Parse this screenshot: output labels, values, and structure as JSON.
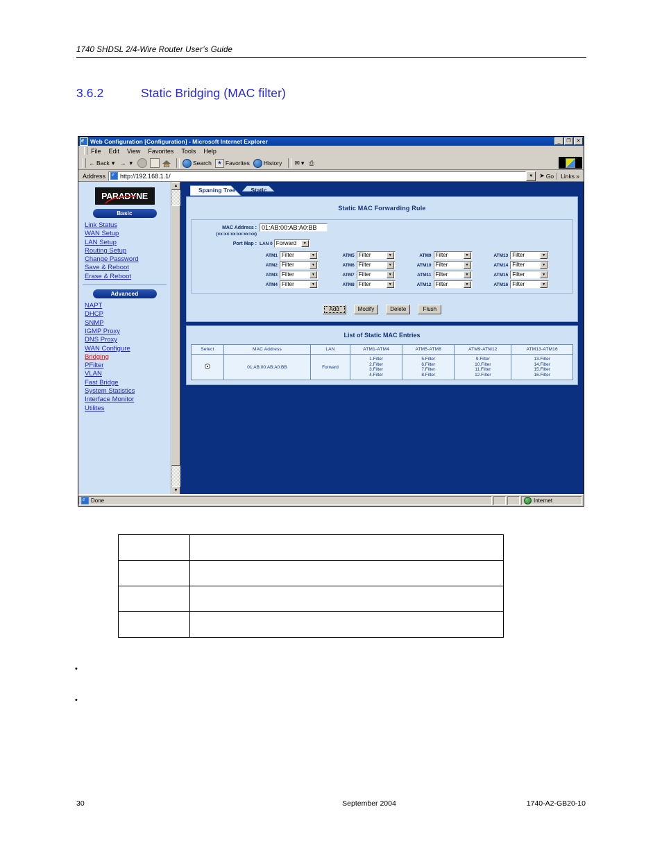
{
  "document": {
    "running_header": "1740 SHDSL 2/4-Wire Router User’s Guide",
    "section_number": "3.6.2",
    "section_title": "Static Bridging (MAC filter)",
    "footer": {
      "page_number": "30",
      "date": "September 2004",
      "doc_number": "1740-A2-GB20-10"
    },
    "bullets": [
      "",
      ""
    ],
    "blank_table": {
      "rows": [
        {
          "c1": "",
          "c2": ""
        },
        {
          "c1": "",
          "c2": ""
        },
        {
          "c1": "",
          "c2": ""
        },
        {
          "c1": "",
          "c2": ""
        }
      ]
    }
  },
  "browser": {
    "title": "Web Configuration [Configuration] - Microsoft Internet Explorer",
    "window_buttons": [
      "_",
      "❐",
      "✕"
    ],
    "menus": [
      "File",
      "Edit",
      "View",
      "Favorites",
      "Tools",
      "Help"
    ],
    "toolbar": [
      {
        "label": "Back",
        "icon": "back-arrow-icon"
      },
      {
        "label": "",
        "icon": "forward-arrow-icon"
      },
      {
        "label": "",
        "icon": "stop-icon"
      },
      {
        "label": "",
        "icon": "refresh-icon"
      },
      {
        "label": "",
        "icon": "home-icon"
      },
      {
        "label": "Search",
        "icon": "search-globe-icon"
      },
      {
        "label": "Favorites",
        "icon": "favorites-star-icon"
      },
      {
        "label": "History",
        "icon": "history-globe-icon"
      },
      {
        "label": "",
        "icon": "mail-icon"
      },
      {
        "label": "",
        "icon": "print-icon"
      }
    ],
    "address_label": "Address",
    "address_value": "http://192.168.1.1/",
    "go_label": "Go",
    "links_label": "Links",
    "status_left": "Done",
    "status_zone": "Internet"
  },
  "nav": {
    "logo": "PARADYNE",
    "basic_label": "Basic",
    "basic_items": [
      "Link Status",
      "WAN Setup",
      "LAN Setup",
      "Routing Setup",
      "Change Password",
      "Save & Reboot",
      "Erase & Reboot"
    ],
    "advanced_label": "Advanced",
    "advanced_items": [
      "NAPT",
      "DHCP",
      "SNMP",
      "IGMP Proxy",
      "DNS Proxy",
      "WAN Configure",
      "Bridging",
      "PFilter",
      "VLAN",
      "Fast Bridge",
      "System Statistics",
      "Interface Monitor",
      "Utilites"
    ],
    "active_item": "Bridging"
  },
  "page": {
    "tabs": [
      {
        "label": "Spaning Tree",
        "active": true
      },
      {
        "label": "Static",
        "active": false
      }
    ],
    "rule_panel": {
      "title": "Static MAC Forwarding Rule",
      "mac_label": "MAC Address :",
      "mac_label_sub": "(xx:xx:xx:xx:xx:xx)",
      "mac_value": "01:AB:00:AB:A0:BB",
      "port_map_label": "Port Map :",
      "lan_name": "LAN 0",
      "lan_value": "Forward",
      "atm_ports": [
        {
          "name": "ATM1",
          "value": "Filter"
        },
        {
          "name": "ATM5",
          "value": "Filter"
        },
        {
          "name": "ATM9",
          "value": "Filter"
        },
        {
          "name": "ATM13",
          "value": "Filter"
        },
        {
          "name": "ATM2",
          "value": "Filter"
        },
        {
          "name": "ATM6",
          "value": "Filter"
        },
        {
          "name": "ATM10",
          "value": "Filter"
        },
        {
          "name": "ATM14",
          "value": "Filter"
        },
        {
          "name": "ATM3",
          "value": "Filter"
        },
        {
          "name": "ATM7",
          "value": "Filter"
        },
        {
          "name": "ATM11",
          "value": "Filter"
        },
        {
          "name": "ATM15",
          "value": "Filter"
        },
        {
          "name": "ATM4",
          "value": "Filter"
        },
        {
          "name": "ATM8",
          "value": "Filter"
        },
        {
          "name": "ATM12",
          "value": "Filter"
        },
        {
          "name": "ATM16",
          "value": "Filter"
        }
      ],
      "buttons": [
        "Add",
        "Modify",
        "Delete",
        "Flush"
      ]
    },
    "list_panel": {
      "title": "List of Static MAC Entries",
      "columns": [
        "Select",
        "MAC Address",
        "LAN",
        "ATM1-ATM4",
        "ATM5-ATM8",
        "ATM9-ATM12",
        "ATM13-ATM16"
      ],
      "rows": [
        {
          "selected": true,
          "mac": "01:AB:00:AB:A0:BB",
          "lan": "Forward",
          "atm1_4": "1.Filter\n2.Filter\n3.Filter\n4.Filter",
          "atm5_8": "5.Filter\n6.Filter\n7.Filter\n8.Filter",
          "atm9_12": "9.Filter\n10.Filter\n11.Filter\n12.Filter",
          "atm13_16": "13.Filter\n14.Filter\n15.Filter\n16.Filter"
        }
      ]
    }
  },
  "colors": {
    "accent_blue": "#2727e0",
    "panel_blue": "#cfe2f5",
    "frame_navy": "#0b3080",
    "link_blue": "#2222cc",
    "active_red": "#e01010"
  }
}
